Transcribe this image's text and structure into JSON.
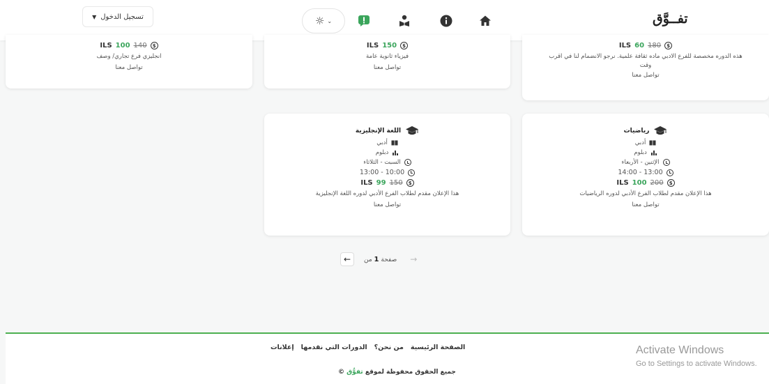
{
  "navbar": {
    "login_label": "تسجيل الدخول",
    "logo": "تفــوَّق",
    "icons": [
      "sun-icon",
      "alert-chat-icon",
      "student-icon",
      "info-icon",
      "home-icon"
    ]
  },
  "top_cards": [
    {
      "price_currency": "ILS",
      "price_new": "100",
      "price_old": "140",
      "line1": "انجليزي فرع تجاري/ وصف",
      "line2": "تواصل معنا"
    },
    {
      "price_currency": "ILS",
      "price_new": "150",
      "line1": "فيزياء ثانوية عامة",
      "line2": "تواصل معنا"
    },
    {
      "price_currency": "ILS",
      "price_new": "60",
      "price_old": "180",
      "line1": "هذه الدوره مخصصة للفرع الادبي ماده ثقافة علمية. نرجو الانضمام لنا في اقرب",
      "line1b": "وقت",
      "line2": "تواصل معنا"
    }
  ],
  "course_cards": [
    {
      "title": "اللغة الإنجليزية",
      "branch": "أدبي",
      "level": "دبلوم",
      "days": "السبت - الثلاثاء",
      "time": "13:00 - 10:00",
      "price_currency": "ILS",
      "price_new": "99",
      "price_old": "150",
      "description": "هذا الإعلان مقدم لطلاب الفرع الأدبي لدوره اللغة الإنجليزية",
      "contact": "تواصل معنا"
    },
    {
      "title": "رياضيات",
      "branch": "أدبي",
      "level": "دبلوم",
      "days": "الإثنين - الأربعاء",
      "time": "14:00 - 13:00",
      "price_currency": "ILS",
      "price_new": "100",
      "price_old": "200",
      "description": "هذا الإعلان مقدم لطلاب الفرع الأدبي لدوره الرياضيات",
      "contact": "تواصل معنا"
    }
  ],
  "pagination": {
    "label": "صفحة",
    "page": "1",
    "of": "من"
  },
  "footer": {
    "links": [
      "الصفحة الرئيسية",
      "من نحن؟",
      "الدورات التي نقدمها",
      "إعلانات"
    ],
    "copyright_prefix": "جميع الحقوق محفوظة لموقع",
    "copyright_brand": "تفوُّق",
    "copyright_symbol": "©"
  },
  "watermark": {
    "title": "Activate Windows",
    "subtitle": "Go to Settings to activate Windows."
  },
  "colors": {
    "accent_green": "#3ba55c",
    "footer_border": "#4caf50"
  }
}
